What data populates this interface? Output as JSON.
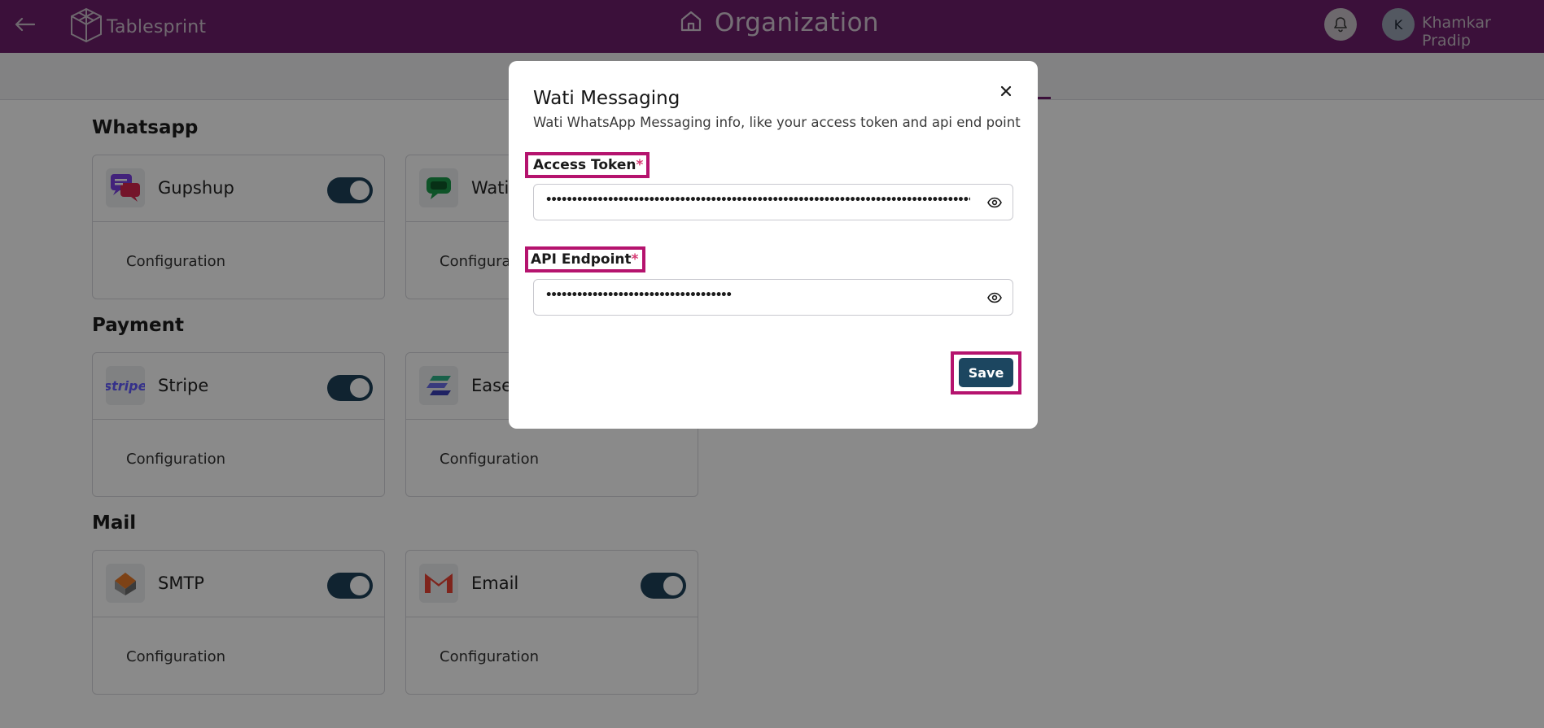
{
  "header": {
    "brand": "Tablesprint",
    "page_title": "Organization",
    "user_initial": "K",
    "user_name": "Khamkar Pradip"
  },
  "sections": {
    "whatsapp": {
      "title": "Whatsapp",
      "cards": [
        {
          "name": "Gupshup",
          "enabled": true,
          "config_label": "Configuration",
          "icon": "gupshup-logo"
        },
        {
          "name": "Wati",
          "config_label": "Configuration",
          "icon": "wati-logo"
        }
      ]
    },
    "payment": {
      "title": "Payment",
      "cards": [
        {
          "name": "Stripe",
          "enabled": true,
          "config_label": "Configuration",
          "icon": "stripe-logo",
          "logo_text": "stripe"
        },
        {
          "name": "Ease",
          "config_label": "Configuration",
          "icon": "easebuzz-logo"
        }
      ]
    },
    "mail": {
      "title": "Mail",
      "cards": [
        {
          "name": "SMTP",
          "enabled": true,
          "config_label": "Configuration",
          "icon": "smtp-logo"
        },
        {
          "name": "Email",
          "enabled": true,
          "config_label": "Configuration",
          "icon": "gmail-logo"
        }
      ]
    }
  },
  "modal": {
    "title": "Wati Messaging",
    "subtitle": "Wati WhatsApp Messaging info, like your access token and api end point",
    "access_token": {
      "label": "Access Token",
      "required_mark": "*",
      "value": "•••••••••••••••••••••••••••••••••••••••••••••••••••••••••••••••••••••••••••••••••••••••••••••••••••••••••••••••••••••••"
    },
    "api_endpoint": {
      "label": "API Endpoint",
      "required_mark": "*",
      "value": "••••••••••••••••••••••••••••••••••••"
    },
    "save_label": "Save"
  },
  "colors": {
    "header_bg": "#6e1f6b",
    "highlight": "#b5136e",
    "primary_button": "#1c4660",
    "toggle_on": "#1f4259"
  }
}
